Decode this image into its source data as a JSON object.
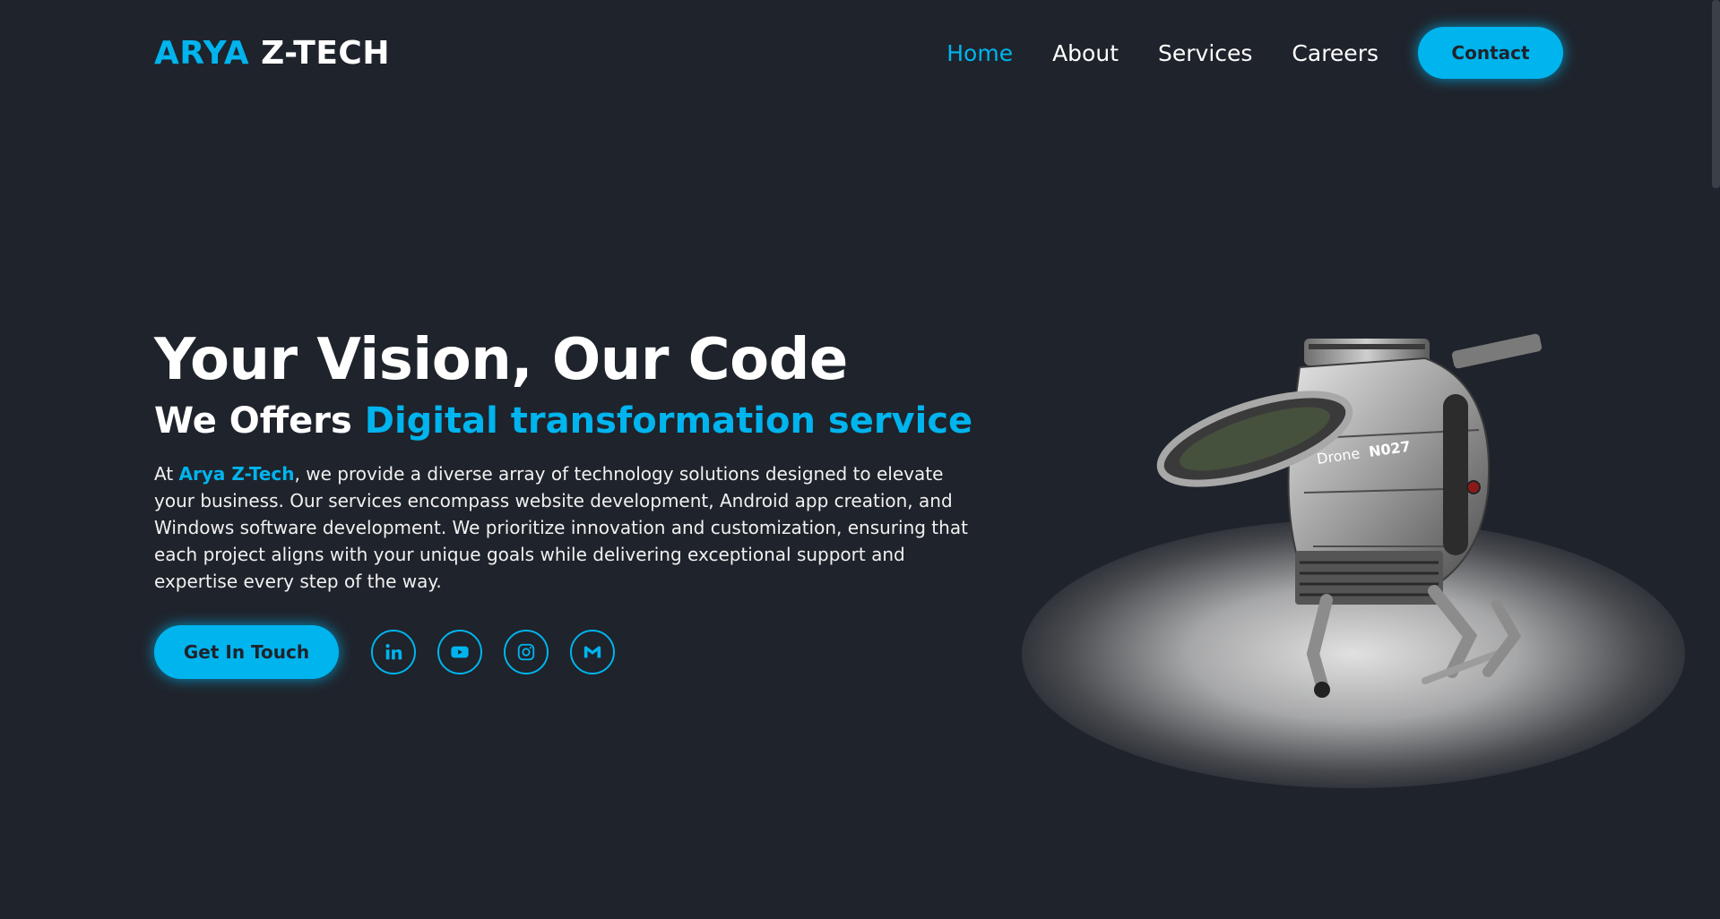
{
  "header": {
    "logo_accent": "ARYA",
    "logo_rest": " Z-TECH",
    "nav": {
      "home": "Home",
      "about": "About",
      "services": "Services",
      "careers": "Careers"
    },
    "contact_label": "Contact"
  },
  "hero": {
    "title": "Your Vision, Our Code",
    "subtitle_prefix": "We Offers ",
    "subtitle_accent": "Digital transformation service",
    "desc_prefix": "At ",
    "desc_brand": "Arya Z-Tech",
    "desc_body": ", we provide a diverse array of technology solutions designed to elevate your business. Our services encompass website development, Android app creation, and Windows software development. We prioritize innovation and customization, ensuring that each project aligns with your unique goals while delivering exceptional support and expertise every step of the way.",
    "cta_label": "Get In Touch"
  },
  "social": [
    "linkedin-icon",
    "youtube-icon",
    "instagram-icon",
    "gmail-icon"
  ],
  "drone": {
    "label": "Drone",
    "model": "N027"
  },
  "colors": {
    "background": "#1f232b",
    "accent": "#00b4ee",
    "text": "#ffffff"
  }
}
